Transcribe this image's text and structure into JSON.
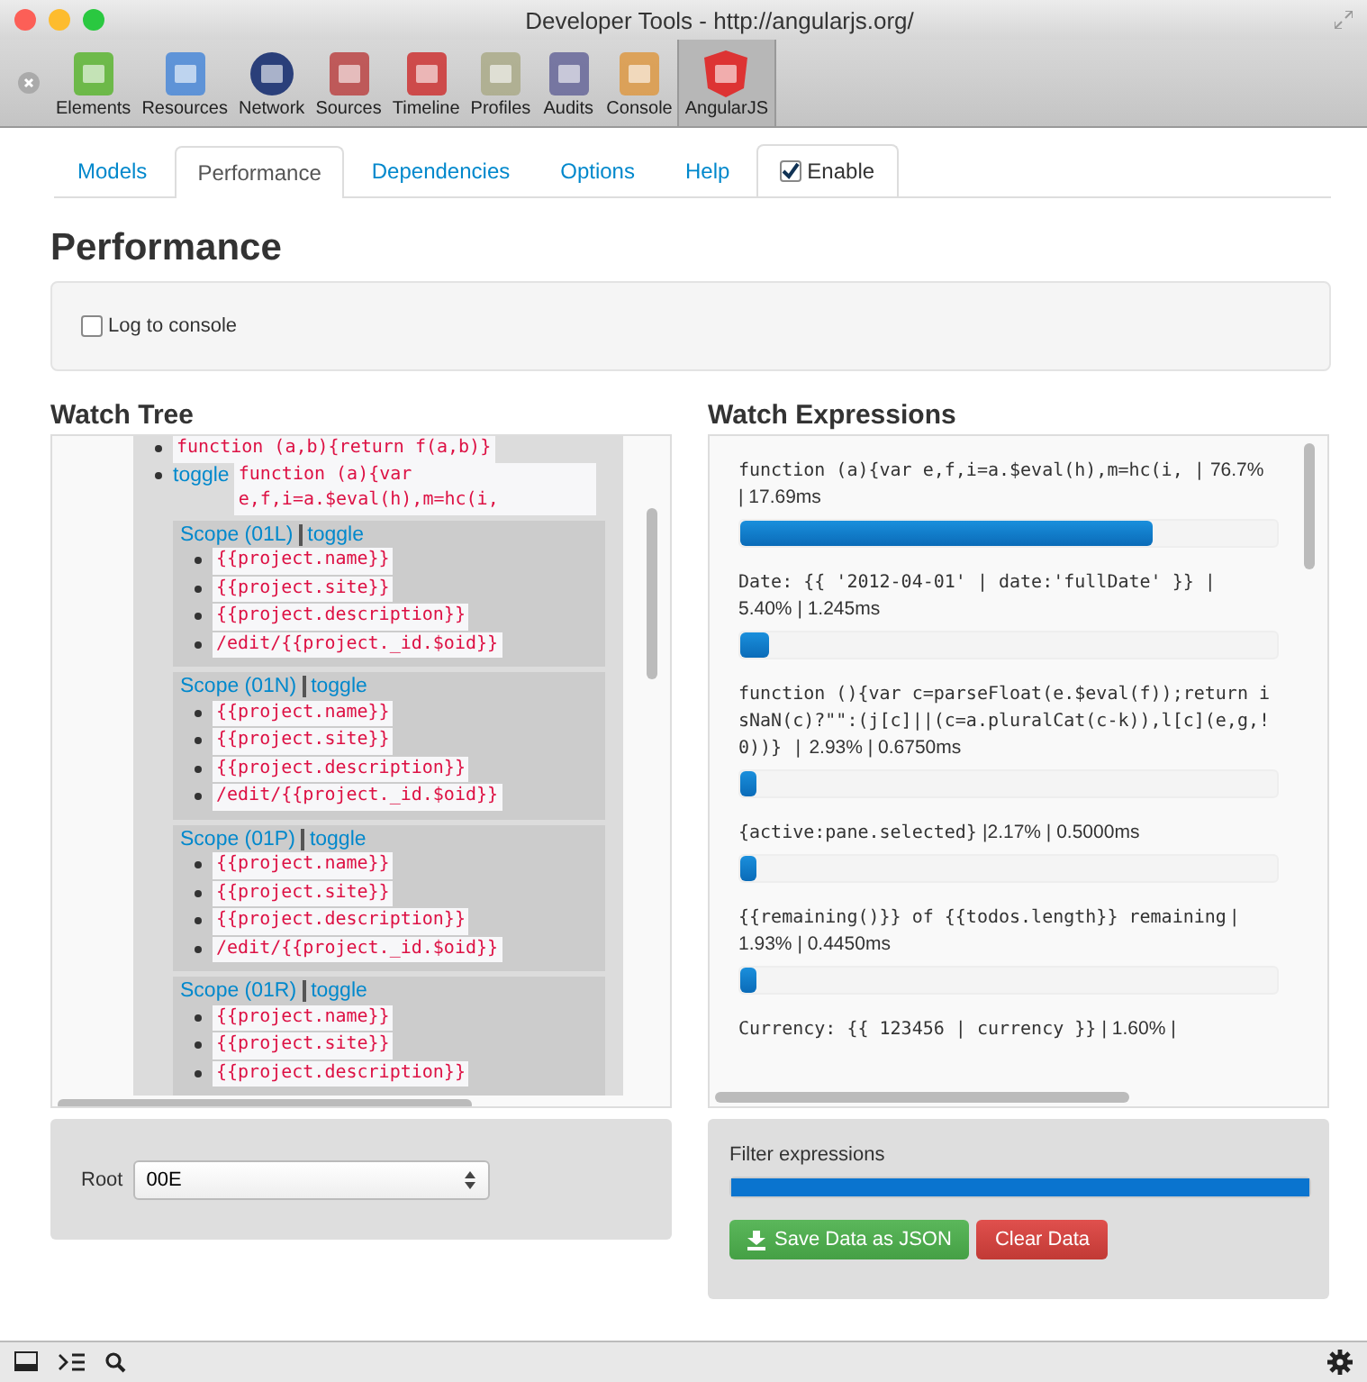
{
  "window": {
    "title": "Developer Tools - http://angularjs.org/"
  },
  "toolbar": [
    {
      "label": "Elements",
      "selected": false
    },
    {
      "label": "Resources",
      "selected": false
    },
    {
      "label": "Network",
      "selected": false
    },
    {
      "label": "Sources",
      "selected": false
    },
    {
      "label": "Timeline",
      "selected": false
    },
    {
      "label": "Profiles",
      "selected": false
    },
    {
      "label": "Audits",
      "selected": false
    },
    {
      "label": "Console",
      "selected": false
    },
    {
      "label": "AngularJS",
      "selected": true
    }
  ],
  "tabs": [
    {
      "kind": "tab",
      "label": "Models",
      "selected": false
    },
    {
      "kind": "tab",
      "label": "Performance",
      "selected": true
    },
    {
      "kind": "tab",
      "label": "Dependencies",
      "selected": false
    },
    {
      "kind": "tab",
      "label": "Options",
      "selected": false
    },
    {
      "kind": "tab",
      "label": "Help",
      "selected": false
    },
    {
      "kind": "checkbox",
      "label": "Enable",
      "checked": true
    }
  ],
  "heading": "Performance",
  "log_option": {
    "label": "Log to console",
    "checked": false
  },
  "watch_tree": {
    "title": "Watch Tree",
    "items": [
      {
        "text": "function (a,b){return f(a,b)}"
      },
      {
        "link": "toggle",
        "text": "function (a){var e,f,i=a.$eval(h),m=hc(i,",
        "children": [
          {
            "scope": "Scope (01L)",
            "link": "toggle",
            "expressions": [
              "{{project.name}}",
              "{{project.site}}",
              "{{project.description}}",
              "/edit/{{project._id.$oid}}"
            ]
          },
          {
            "scope": "Scope (01N)",
            "link": "toggle",
            "expressions": [
              "{{project.name}}",
              "{{project.site}}",
              "{{project.description}}",
              "/edit/{{project._id.$oid}}"
            ]
          },
          {
            "scope": "Scope (01P)",
            "link": "toggle",
            "expressions": [
              "{{project.name}}",
              "{{project.site}}",
              "{{project.description}}",
              "/edit/{{project._id.$oid}}"
            ]
          },
          {
            "scope": "Scope (01R)",
            "link": "toggle",
            "expressions": [
              "{{project.name}}",
              "{{project.site}}",
              "{{project.description}}"
            ]
          }
        ]
      }
    ],
    "root_label": "Root",
    "root_value": "00E"
  },
  "watch_expressions": {
    "title": "Watch Expressions",
    "items": [
      {
        "expression": "function (a){var e,f,i=a.$eval(h),m=hc(i, |",
        "stats": "76.7% | 17.69ms",
        "level": 0.767
      },
      {
        "expression": "Date: {{ '2012-04-01' | date:'fullDate' }} |",
        "stats": "5.40% | 1.245ms",
        "level": 0.054
      },
      {
        "expression": "function (){var c=parseFloat(e.$eval(f));return isNaN(c)?\"\":(j[c]||(c=a.pluralCat(c-k)),l[c](e,g,!0))} |",
        "stats": "2.93% | 0.6750ms",
        "level": 0.0293
      },
      {
        "expression": "{active:pane.selected}",
        "stats": "|2.17% | 0.5000ms",
        "level": 0.0217
      },
      {
        "expression": "{{remaining()}} of {{todos.length}} remaining",
        "stats": "| 1.93% | 0.4450ms",
        "level": 0.0193
      },
      {
        "expression": "Currency: {{ 123456 | currency }}",
        "stats": "| 1.60% |"
      }
    ],
    "filter_label": "Filter expressions",
    "buttons": [
      {
        "kind": "save",
        "label": "Save Data as JSON"
      },
      {
        "kind": "clear",
        "label": "Clear Data"
      }
    ]
  }
}
